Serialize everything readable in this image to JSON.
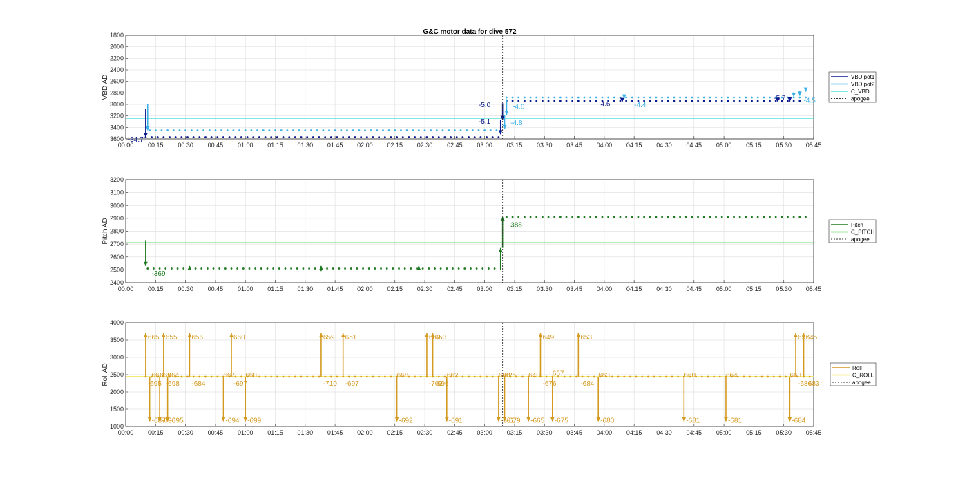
{
  "title": "G&C motor data for dive 572",
  "colors": {
    "vbd1": "#0a1a8c",
    "vbd2": "#3ab0e8",
    "cvbd": "#55e0dc",
    "pitch": "#1f7a22",
    "cpitch": "#3ecf3e",
    "roll": "#d49a20",
    "croll": "#f2e24a",
    "apogee": "#333333",
    "grid": "#e2e2e2"
  },
  "chart_data": [
    {
      "type": "scatter",
      "ylabel": "VBD AD",
      "ylim": [
        1800,
        3600
      ],
      "y_reversed": true,
      "yticks": [
        1800,
        2000,
        2200,
        2400,
        2600,
        2800,
        3000,
        3200,
        3400,
        3600
      ],
      "xlim_minutes": [
        0,
        345
      ],
      "xticks_minutes": [
        0,
        15,
        30,
        45,
        60,
        75,
        90,
        105,
        120,
        135,
        150,
        165,
        180,
        195,
        210,
        225,
        240,
        255,
        270,
        285,
        300,
        315,
        330,
        345
      ],
      "xticklabels": [
        "00:00",
        "00:15",
        "00:30",
        "00:45",
        "01:00",
        "01:15",
        "01:30",
        "01:45",
        "02:00",
        "02:15",
        "02:30",
        "02:45",
        "03:00",
        "03:15",
        "03:30",
        "03:45",
        "04:00",
        "04:15",
        "04:30",
        "04:45",
        "05:00",
        "05:15",
        "05:30",
        "05:45"
      ],
      "apogee_minutes": 189,
      "grid": true,
      "legend_position": "right",
      "legend": [
        "VBD pot1",
        "VBD pot2",
        "C_VBD",
        "apogee"
      ],
      "constant_line": {
        "name": "C_VBD",
        "value": 3240
      },
      "series": [
        {
          "name": "VBD pot1",
          "dots": {
            "from": 10,
            "to": 188,
            "step": 3,
            "value": 3570
          },
          "dots2": {
            "from": 191,
            "to": 338,
            "step": 3,
            "value": 2940
          }
        },
        {
          "name": "VBD pot2",
          "dots": {
            "from": 12,
            "to": 188,
            "step": 3,
            "value": 3450
          },
          "dots2": {
            "from": 191,
            "to": 342,
            "step": 3,
            "value": 2880
          }
        }
      ],
      "events": [
        {
          "series": "VBD pot1",
          "x": 10,
          "y0": 3080,
          "y1": 3570
        },
        {
          "series": "VBD pot2",
          "x": 11,
          "y0": 3000,
          "y1": 3450
        },
        {
          "series": "VBD pot1",
          "x": 188,
          "y0": 3270,
          "y1": 3520
        },
        {
          "series": "VBD pot1",
          "x": 189,
          "y0": 2980,
          "y1": 3270
        },
        {
          "series": "VBD pot2",
          "x": 190,
          "y0": 3180,
          "y1": 3430
        },
        {
          "series": "VBD pot2",
          "x": 191,
          "y0": 2910,
          "y1": 3180
        },
        {
          "series": "VBD pot1",
          "x": 249,
          "y0": 2920,
          "y1": 2960
        },
        {
          "series": "VBD pot2",
          "x": 250,
          "y0": 2850,
          "y1": 2900
        },
        {
          "series": "VBD pot1",
          "x": 327,
          "y0": 2920,
          "y1": 2960
        },
        {
          "series": "VBD pot1",
          "x": 333,
          "y0": 2900,
          "y1": 2950
        },
        {
          "series": "VBD pot2",
          "x": 335,
          "y0": 2790,
          "y1": 2870
        },
        {
          "series": "VBD pot2",
          "x": 338,
          "y0": 2770,
          "y1": 2850
        },
        {
          "series": "VBD pot2",
          "x": 341,
          "y0": 2730,
          "y1": 2780
        }
      ],
      "annotations": [
        {
          "text": "-34.7",
          "x": 1,
          "y": 3600,
          "color": "vbd1"
        },
        {
          "text": "-5.0",
          "x": 177,
          "y": 3000,
          "color": "vbd1"
        },
        {
          "text": "-5.1",
          "x": 177,
          "y": 3290,
          "color": "vbd1"
        },
        {
          "text": "-4.6",
          "x": 194,
          "y": 3030,
          "color": "vbd2"
        },
        {
          "text": "-4.8",
          "x": 193,
          "y": 3310,
          "color": "vbd2"
        },
        {
          "text": "-4.6",
          "x": 237,
          "y": 2980,
          "color": "vbd1"
        },
        {
          "text": "-4.4",
          "x": 255,
          "y": 3000,
          "color": "vbd2"
        },
        {
          "text": "-5.7",
          "x": 325,
          "y": 2880,
          "color": "vbd1"
        },
        {
          "text": "-4.5",
          "x": 340,
          "y": 2920,
          "color": "vbd2"
        }
      ]
    },
    {
      "type": "scatter",
      "ylabel": "Pitch AD",
      "ylim": [
        2400,
        3200
      ],
      "y_reversed": false,
      "yticks": [
        2400,
        2500,
        2600,
        2700,
        2800,
        2900,
        3000,
        3100,
        3200
      ],
      "xlim_minutes": [
        0,
        345
      ],
      "xticks_minutes": [
        0,
        15,
        30,
        45,
        60,
        75,
        90,
        105,
        120,
        135,
        150,
        165,
        180,
        195,
        210,
        225,
        240,
        255,
        270,
        285,
        300,
        315,
        330,
        345
      ],
      "xticklabels": [
        "00:00",
        "00:15",
        "00:30",
        "00:45",
        "01:00",
        "01:15",
        "01:30",
        "01:45",
        "02:00",
        "02:15",
        "02:30",
        "02:45",
        "03:00",
        "03:15",
        "03:30",
        "03:45",
        "04:00",
        "04:15",
        "04:30",
        "04:45",
        "05:00",
        "05:15",
        "05:30",
        "05:45"
      ],
      "apogee_minutes": 189,
      "grid": true,
      "legend_position": "right",
      "legend": [
        "Pitch",
        "C_PITCH",
        "apogee"
      ],
      "constant_line": {
        "name": "C_PITCH",
        "value": 2710
      },
      "series": [
        {
          "name": "Pitch",
          "dots": {
            "from": 11,
            "to": 187,
            "step": 3,
            "value": 2510
          },
          "dots2": {
            "from": 191,
            "to": 343,
            "step": 3,
            "value": 2910
          }
        }
      ],
      "events": [
        {
          "series": "Pitch",
          "x": 10,
          "y0": 2730,
          "y1": 2530
        },
        {
          "series": "Pitch",
          "x": 32,
          "y0": 2500,
          "y1": 2530
        },
        {
          "series": "Pitch",
          "x": 98,
          "y0": 2490,
          "y1": 2530
        },
        {
          "series": "Pitch",
          "x": 147,
          "y0": 2500,
          "y1": 2530
        },
        {
          "series": "Pitch",
          "x": 188,
          "y0": 2500,
          "y1": 2670
        },
        {
          "series": "Pitch",
          "x": 189,
          "y0": 2670,
          "y1": 2910
        }
      ],
      "annotations": [
        {
          "text": "-369",
          "x": 13,
          "y": 2475,
          "color": "pitch"
        },
        {
          "text": "388",
          "x": 193,
          "y": 2855,
          "color": "pitch"
        }
      ]
    },
    {
      "type": "scatter",
      "ylabel": "Roll AD",
      "ylim": [
        1000,
        4000
      ],
      "y_reversed": false,
      "yticks": [
        1000,
        1500,
        2000,
        2500,
        3000,
        3500,
        4000
      ],
      "xlim_minutes": [
        0,
        345
      ],
      "xticks_minutes": [
        0,
        15,
        30,
        45,
        60,
        75,
        90,
        105,
        120,
        135,
        150,
        165,
        180,
        195,
        210,
        225,
        240,
        255,
        270,
        285,
        300,
        315,
        330,
        345
      ],
      "xticklabels": [
        "00:00",
        "00:15",
        "00:30",
        "00:45",
        "01:00",
        "01:15",
        "01:30",
        "01:45",
        "02:00",
        "02:15",
        "02:30",
        "02:45",
        "03:00",
        "03:15",
        "03:30",
        "03:45",
        "04:00",
        "04:15",
        "04:30",
        "04:45",
        "05:00",
        "05:15",
        "05:30",
        "05:45"
      ],
      "apogee_minutes": 189,
      "grid": true,
      "legend_position": "right",
      "legend": [
        "Roll",
        "C_ROLL",
        "apogee"
      ],
      "constant_line": {
        "name": "C_ROLL",
        "value": 2440
      },
      "series": [
        {
          "name": "Roll",
          "dots": {
            "from": 10,
            "to": 343,
            "step": 3,
            "value": 2440
          }
        }
      ],
      "events": [
        {
          "series": "Roll",
          "x": 10,
          "y0": 2440,
          "y1": 3700,
          "label": "665",
          "label2": "-695"
        },
        {
          "series": "Roll",
          "x": 12,
          "y0": 2440,
          "y1": 1150,
          "label": "-687"
        },
        {
          "series": "Roll",
          "x": 17,
          "y0": 2440,
          "y1": 1150,
          "label": "-696"
        },
        {
          "series": "Roll",
          "x": 19,
          "y0": 2440,
          "y1": 3700,
          "label": "655",
          "label2": "-698"
        },
        {
          "series": "Roll",
          "x": 21,
          "y0": 2440,
          "y1": 1150,
          "label": "-695"
        },
        {
          "series": "Roll",
          "x": 32,
          "y0": 2440,
          "y1": 3700,
          "label": "656",
          "label2": "-684"
        },
        {
          "series": "Roll",
          "x": 49,
          "y0": 2440,
          "y1": 1150,
          "label": "-694"
        },
        {
          "series": "Roll",
          "x": 53,
          "y0": 2440,
          "y1": 3700,
          "label": "660",
          "label2": "-697"
        },
        {
          "series": "Roll",
          "x": 60,
          "y0": 2440,
          "y1": 1150,
          "label": "-699"
        },
        {
          "series": "Roll",
          "x": 98,
          "y0": 2440,
          "y1": 3700,
          "label": "659",
          "label2": "-710"
        },
        {
          "series": "Roll",
          "x": 109,
          "y0": 2440,
          "y1": 3700,
          "label": "651",
          "label2": "-697"
        },
        {
          "series": "Roll",
          "x": 136,
          "y0": 2440,
          "y1": 1150,
          "label": "-692"
        },
        {
          "series": "Roll",
          "x": 151,
          "y0": 2440,
          "y1": 3700,
          "label": "660",
          "label2": "-702"
        },
        {
          "series": "Roll",
          "x": 154,
          "y0": 2440,
          "y1": 3700,
          "label": "653",
          "label2": "-696"
        },
        {
          "series": "Roll",
          "x": 161,
          "y0": 2440,
          "y1": 1150,
          "label": "-691"
        },
        {
          "series": "Roll",
          "x": 187,
          "y0": 2440,
          "y1": 1150,
          "label": "-681"
        },
        {
          "series": "Roll",
          "x": 190,
          "y0": 2440,
          "y1": 1150,
          "label": "-679"
        },
        {
          "series": "Roll",
          "x": 202,
          "y0": 2440,
          "y1": 1150,
          "label": "-665"
        },
        {
          "series": "Roll",
          "x": 208,
          "y0": 2440,
          "y1": 3700,
          "label": "649",
          "label2": "-676"
        },
        {
          "series": "Roll",
          "x": 214,
          "y0": 2440,
          "y1": 1150,
          "label": "-675"
        },
        {
          "series": "Roll",
          "x": 227,
          "y0": 2440,
          "y1": 3700,
          "label": "653",
          "label2": "-684"
        },
        {
          "series": "Roll",
          "x": 237,
          "y0": 2440,
          "y1": 1150,
          "label": "-680"
        },
        {
          "series": "Roll",
          "x": 280,
          "y0": 2440,
          "y1": 1150,
          "label": "-681"
        },
        {
          "series": "Roll",
          "x": 301,
          "y0": 2440,
          "y1": 1150,
          "label": "-681"
        },
        {
          "series": "Roll",
          "x": 333,
          "y0": 2440,
          "y1": 1150,
          "label": "-684"
        },
        {
          "series": "Roll",
          "x": 336,
          "y0": 2440,
          "y1": 3700,
          "label": "657",
          "label2": "-686"
        },
        {
          "series": "Roll",
          "x": 340,
          "y0": 2440,
          "y1": 3700,
          "label": "645",
          "label2": "-683"
        }
      ],
      "annotations": [
        {
          "text": "663",
          "x": 13,
          "y": 2500,
          "color": "roll"
        },
        {
          "text": "669",
          "x": 17,
          "y": 2500,
          "color": "roll"
        },
        {
          "text": "664",
          "x": 21,
          "y": 2500,
          "color": "roll"
        },
        {
          "text": "667",
          "x": 49,
          "y": 2500,
          "color": "roll"
        },
        {
          "text": "668",
          "x": 60,
          "y": 2500,
          "color": "roll"
        },
        {
          "text": "668",
          "x": 136,
          "y": 2500,
          "color": "roll"
        },
        {
          "text": "662",
          "x": 161,
          "y": 2500,
          "color": "roll"
        },
        {
          "text": "668",
          "x": 187,
          "y": 2500,
          "color": "roll"
        },
        {
          "text": "625",
          "x": 190,
          "y": 2500,
          "color": "roll"
        },
        {
          "text": "648",
          "x": 202,
          "y": 2500,
          "color": "roll"
        },
        {
          "text": "657",
          "x": 214,
          "y": 2550,
          "color": "roll"
        },
        {
          "text": "663",
          "x": 237,
          "y": 2500,
          "color": "roll"
        },
        {
          "text": "660",
          "x": 280,
          "y": 2500,
          "color": "roll"
        },
        {
          "text": "664",
          "x": 301,
          "y": 2500,
          "color": "roll"
        },
        {
          "text": "663",
          "x": 333,
          "y": 2500,
          "color": "roll"
        }
      ]
    }
  ]
}
